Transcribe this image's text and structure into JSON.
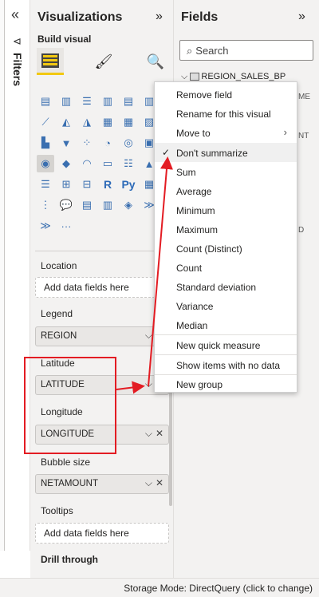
{
  "filters_strip": {
    "collapse_icon": "«",
    "label": "Filters"
  },
  "visualizations": {
    "title": "Visualizations",
    "expand_icon": "»",
    "build_visual_label": "Build visual",
    "more_label": "···"
  },
  "wells": {
    "location": {
      "label": "Location",
      "placeholder": "Add data fields here"
    },
    "legend": {
      "label": "Legend",
      "field": "REGION"
    },
    "latitude": {
      "label": "Latitude",
      "field": "LATITUDE"
    },
    "longitude": {
      "label": "Longitude",
      "field": "LONGITUDE"
    },
    "bubble_size": {
      "label": "Bubble size",
      "field": "NETAMOUNT"
    },
    "tooltips": {
      "label": "Tooltips",
      "placeholder": "Add data fields here"
    },
    "drill_through": {
      "label": "Drill through"
    }
  },
  "fields": {
    "title": "Fields",
    "expand_icon": "»",
    "search_placeholder": "Search",
    "table_name": "REGION_SALES_BP",
    "frag_me": "ME",
    "frag_nt": "NT",
    "frag_d": "D"
  },
  "menu": {
    "items": [
      "Remove field",
      "Rename for this visual",
      "Move to",
      "Don't summarize",
      "Sum",
      "Average",
      "Minimum",
      "Maximum",
      "Count (Distinct)",
      "Count",
      "Standard deviation",
      "Variance",
      "Median",
      "New quick measure",
      "Show items with no data",
      "New group"
    ],
    "checked_item": "Don't summarize"
  },
  "status": {
    "text": "Storage Mode: DirectQuery (click to change)"
  },
  "colors": {
    "accent": "#f2c811",
    "annotation": "#e31c23"
  }
}
